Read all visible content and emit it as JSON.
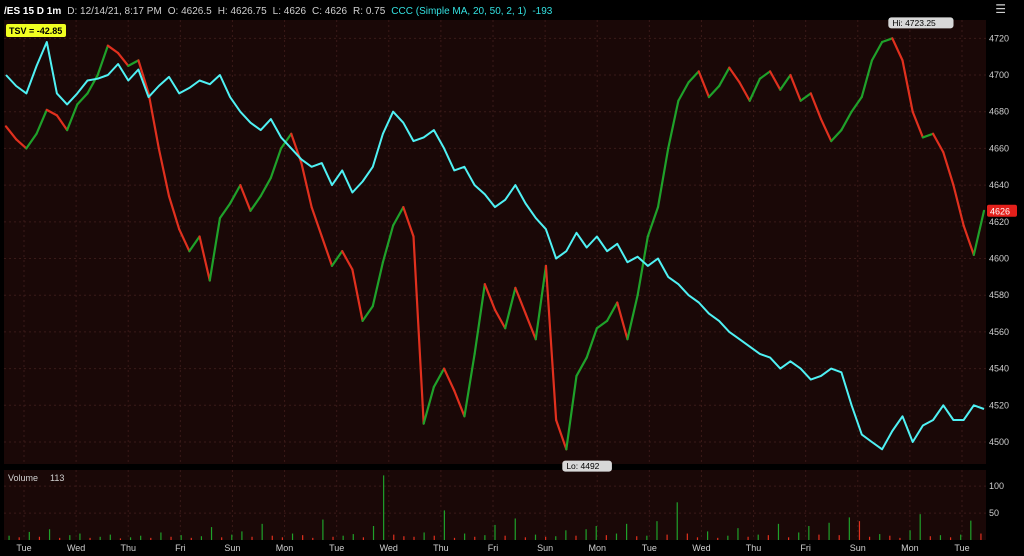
{
  "header": {
    "symbol": "/ES 15 D 1m",
    "date": "D: 12/14/21, 8:17 PM",
    "open": "O: 4626.5",
    "high": "H: 4626.75",
    "low": "L: 4626",
    "close": "C: 4626",
    "range": "R: 0.75",
    "study": "CCC (Simple MA, 20, 50, 2, 1)",
    "study_value": "-193",
    "tsv_badge": "TSV = -42.85"
  },
  "colors": {
    "background": "#1a0807",
    "grid": "#3a1a18",
    "cyan": "#4ff1f4",
    "up": "#1fa12a",
    "down": "#e0301e",
    "price_tag": "#e4201b",
    "tsv_badge": "#f2ff21"
  },
  "chart_data": [
    {
      "type": "line",
      "title": "",
      "x_tick_labels": [
        "Tue",
        "Wed",
        "Thu",
        "Fri",
        "Sun",
        "Mon",
        "Tue",
        "Wed",
        "Thu",
        "Fri",
        "Sun",
        "Mon",
        "Tue",
        "Wed",
        "Thu",
        "Fri",
        "Sun",
        "Mon",
        "Tue"
      ],
      "y_ticks": [
        4500,
        4520,
        4540,
        4560,
        4580,
        4600,
        4620,
        4640,
        4660,
        4680,
        4700,
        4720
      ],
      "ylim": [
        4488,
        4730
      ],
      "grid": true,
      "last_price_label": "4626",
      "last_price": 4626,
      "annotations": [
        {
          "text": "Hi: 4723.25",
          "value": 4723.25
        },
        {
          "text": "Lo: 4492",
          "value": 4492
        }
      ],
      "series": [
        {
          "kind": "price",
          "values": [
            4672,
            4665,
            4660,
            4668,
            4681,
            4678,
            4670,
            4684,
            4690,
            4700,
            4716,
            4712,
            4705,
            4708,
            4690,
            4660,
            4634,
            4616,
            4604,
            4612,
            4588,
            4622,
            4630,
            4640,
            4626,
            4634,
            4644,
            4660,
            4668,
            4652,
            4628,
            4612,
            4596,
            4604,
            4594,
            4566,
            4574,
            4598,
            4618,
            4628,
            4612,
            4510,
            4530,
            4540,
            4528,
            4514,
            4548,
            4586,
            4572,
            4562,
            4584,
            4570,
            4556,
            4596,
            4512,
            4496,
            4536,
            4546,
            4562,
            4566,
            4576,
            4556,
            4580,
            4612,
            4628,
            4660,
            4686,
            4696,
            4702,
            4688,
            4694,
            4704,
            4696,
            4686,
            4698,
            4702,
            4692,
            4700,
            4686,
            4690,
            4676,
            4664,
            4670,
            4680,
            4688,
            4708,
            4718,
            4720,
            4708,
            4680,
            4666,
            4668,
            4658,
            4640,
            4618,
            4602,
            4626
          ]
        },
        {
          "kind": "study",
          "values": [
            4700,
            4694,
            4690,
            4705,
            4718,
            4690,
            4684,
            4690,
            4697,
            4698,
            4700,
            4706,
            4697,
            4703,
            4688,
            4694,
            4699,
            4690,
            4693,
            4697,
            4695,
            4700,
            4688,
            4680,
            4674,
            4670,
            4676,
            4666,
            4660,
            4654,
            4650,
            4652,
            4640,
            4648,
            4636,
            4642,
            4650,
            4668,
            4680,
            4674,
            4664,
            4666,
            4670,
            4660,
            4648,
            4650,
            4640,
            4635,
            4628,
            4632,
            4640,
            4630,
            4622,
            4616,
            4600,
            4604,
            4614,
            4606,
            4612,
            4604,
            4608,
            4598,
            4601,
            4596,
            4600,
            4590,
            4586,
            4580,
            4576,
            4570,
            4566,
            4560,
            4556,
            4552,
            4548,
            4546,
            4540,
            4544,
            4540,
            4534,
            4536,
            4540,
            4538,
            4520,
            4504,
            4500,
            4496,
            4506,
            4514,
            4500,
            4509,
            4512,
            4520,
            4512,
            4512,
            4520,
            4518
          ]
        }
      ]
    },
    {
      "type": "bar",
      "title": "Volume",
      "title_value": "113",
      "y_ticks": [
        50,
        100
      ],
      "ylim": [
        0,
        130
      ],
      "values": [
        8,
        5,
        15,
        6,
        20,
        4,
        9,
        12,
        4,
        6,
        10,
        3,
        5,
        8,
        4,
        14,
        6,
        9,
        4,
        7,
        24,
        5,
        10,
        16,
        6,
        30,
        8,
        5,
        12,
        9,
        4,
        38,
        6,
        8,
        11,
        5,
        26,
        120,
        10,
        7,
        6,
        14,
        8,
        55,
        4,
        12,
        6,
        9,
        28,
        8,
        40,
        5,
        10,
        6,
        7,
        18,
        8,
        20,
        26,
        9,
        12,
        30,
        7,
        8,
        35,
        10,
        70,
        12,
        5,
        16,
        4,
        8,
        22,
        6,
        10,
        9,
        30,
        5,
        14,
        26,
        10,
        32,
        9,
        42,
        35,
        6,
        11,
        8,
        4,
        18,
        48,
        7,
        9,
        5,
        10,
        36,
        12
      ]
    }
  ]
}
